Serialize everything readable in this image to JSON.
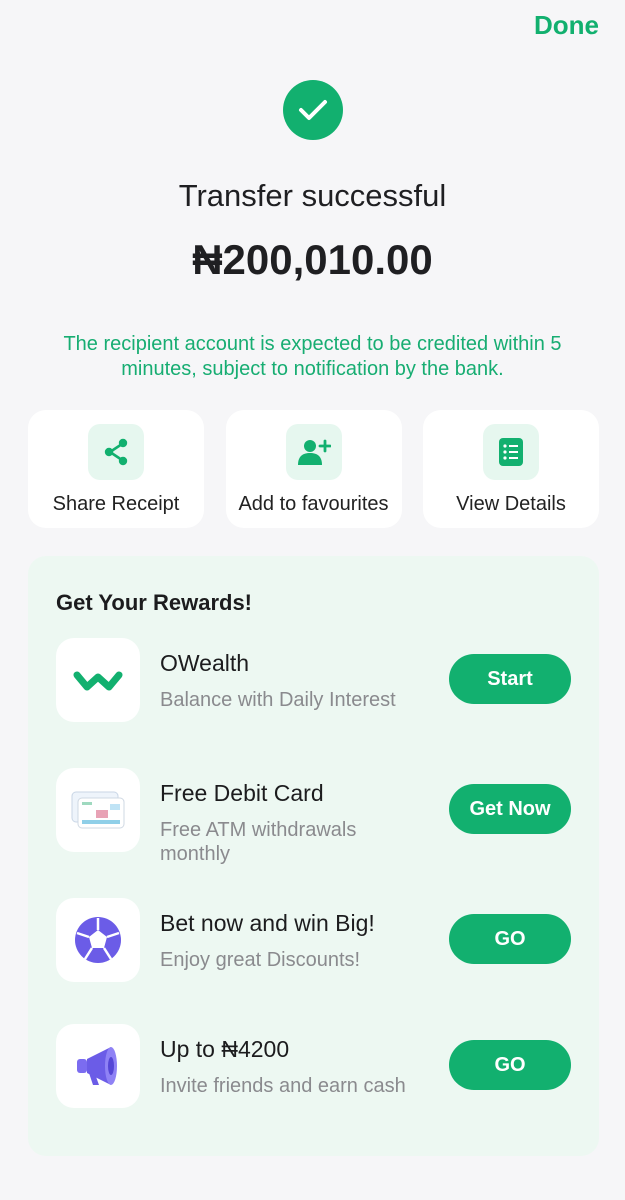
{
  "header": {
    "done_label": "Done"
  },
  "status": {
    "title": "Transfer successful",
    "amount": "₦200,010.00",
    "notice": "The recipient account is expected to be credited within 5 minutes, subject to notification by the bank.",
    "accent_color": "#12b06f"
  },
  "actions": [
    {
      "label": "Share Receipt",
      "icon": "share-icon"
    },
    {
      "label": "Add to favourites",
      "icon": "add-user-icon"
    },
    {
      "label": "View Details",
      "icon": "list-icon"
    }
  ],
  "rewards": {
    "title": "Get Your Rewards!",
    "items": [
      {
        "name": "OWealth",
        "description": "Balance with Daily Interest",
        "button": "Start",
        "icon": "owealth-logo-icon"
      },
      {
        "name": "Free Debit Card",
        "description": "Free ATM withdrawals monthly",
        "button": "Get Now",
        "icon": "debit-card-icon"
      },
      {
        "name": "Bet now and win Big!",
        "description": "Enjoy great Discounts!",
        "button": "GO",
        "icon": "soccer-ball-icon"
      },
      {
        "name": "Up to ₦4200",
        "description": "Invite friends and earn cash",
        "button": "GO",
        "icon": "megaphone-icon"
      }
    ]
  }
}
